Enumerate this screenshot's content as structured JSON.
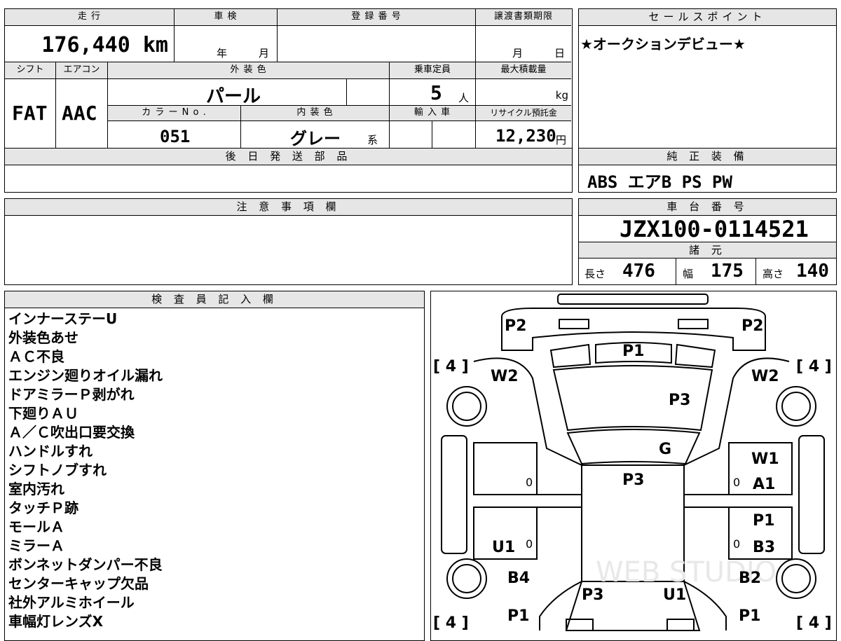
{
  "top_fields": {
    "mileage_label": "走 行",
    "mileage_value": "176,440",
    "mileage_unit": "km",
    "shaken_label": "車 検",
    "shaken_year": "年",
    "shaken_month": "月",
    "reg_label": "登 録 番 号",
    "transfer_label": "譲渡書類期限",
    "transfer_month": "月",
    "transfer_day": "日",
    "shift_label": "シフト",
    "shift_value": "FAT",
    "ac_label": "エアコン",
    "ac_value": "AAC",
    "exterior_label": "外 装 色",
    "exterior_value": "パール",
    "capacity_label": "乗車定員",
    "capacity_value": "5",
    "capacity_unit": "人",
    "maxload_label": "最大積載量",
    "maxload_unit": "kg",
    "colorno_label": "カ ラ ー N o .",
    "colorno_value": "051",
    "interior_label": "内 装 色",
    "interior_value": "グレー",
    "interior_suffix": "系",
    "import_label": "輸 入 車",
    "recycle_label": "リサイクル預託金",
    "recycle_value": "12,230",
    "recycle_unit": "円",
    "later_parts_label": "後 日 発 送 部 品"
  },
  "sales_point": {
    "label": "セールスポイント",
    "text": "★オークションデビュー★"
  },
  "equipment": {
    "label": "純 正 装 備",
    "items": "ABS エアB PS PW"
  },
  "notice": {
    "label": "注 意 事 項 欄"
  },
  "chassis": {
    "label": "車 台 番 号",
    "value": "JZX100-0114521",
    "spec_label": "諸 元",
    "length_label": "長さ",
    "length_value": "476",
    "width_label": "幅",
    "width_value": "175",
    "height_label": "高さ",
    "height_value": "140"
  },
  "inspector": {
    "label": "検 査 員 記 入 欄",
    "notes": [
      "インナーステーU",
      "外装色あせ",
      "ＡＣ不良",
      "エンジン廻りオイル漏れ",
      "ドアミラーＰ剥がれ",
      "下廻りＡＵ",
      "Ａ／Ｃ吹出口要交換",
      "ハンドルすれ",
      "シフトノブすれ",
      "室内汚れ",
      "タッチＰ跡",
      "モールＡ",
      "ミラーＡ",
      "ボンネットダンパー不良",
      "センターキャップ欠品",
      "社外アルミホイール",
      "車幅灯レンズX"
    ]
  },
  "diagram": {
    "watermark": "WEB STUDIO",
    "marks": {
      "rear_left": "P2",
      "rear_right": "P2",
      "rear_glass": "P1",
      "trunk": "P3",
      "roof": "G",
      "cabin": "P3",
      "w2_left": "W2",
      "w2_right": "W2",
      "w1": "W1",
      "a1": "A1",
      "p1_right": "P1",
      "b3": "B3",
      "u1_left": "U1",
      "b4": "B4",
      "b2": "B2",
      "hood_left": "P3",
      "hood_right": "U1",
      "front_left": "P1",
      "front_right": "P1",
      "tire_tl": "[ 4 ]",
      "tire_tr": "[ 4 ]",
      "tire_bl": "[ 4 ]",
      "tire_br": "[ 4 ]",
      "zero": "0"
    }
  }
}
